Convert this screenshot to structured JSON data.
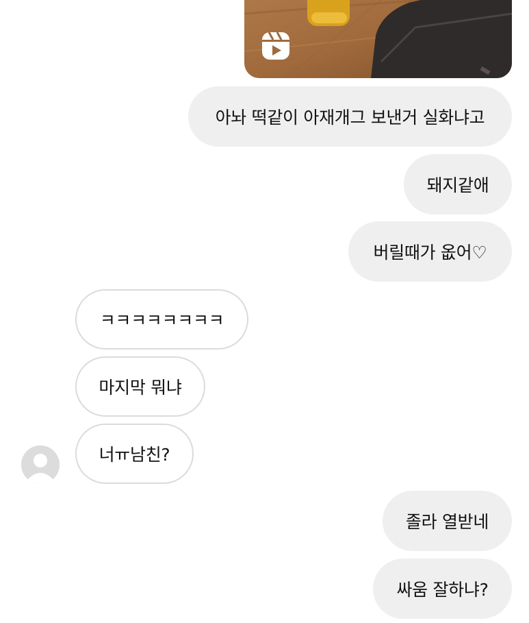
{
  "thread": {
    "shared_reel": {
      "icon": "reels-icon"
    },
    "messages": [
      {
        "id": "m1",
        "direction": "outgoing",
        "text": "아놔 떡같이 아재개그 보낸거 실화냐고"
      },
      {
        "id": "m2",
        "direction": "outgoing",
        "text": "돼지같애"
      },
      {
        "id": "m3",
        "direction": "outgoing",
        "text": "버릴때가 옶어♡"
      },
      {
        "id": "m4",
        "direction": "incoming",
        "text": "ㅋㅋㅋㅋㅋㅋㅋㅋ"
      },
      {
        "id": "m5",
        "direction": "incoming",
        "text": "마지막 뭐냐"
      },
      {
        "id": "m6",
        "direction": "incoming",
        "text": "너ㅠ남친?"
      },
      {
        "id": "m7",
        "direction": "outgoing",
        "text": "졸라 열받네"
      },
      {
        "id": "m8",
        "direction": "outgoing",
        "text": "싸움 잘하냐?"
      }
    ],
    "avatar_icon": "default-profile-avatar-icon"
  },
  "colors": {
    "outgoing_bubble": "#efefef",
    "incoming_border": "#dbdbdb",
    "text": "#111111",
    "avatar_bg": "#dcdcdc"
  }
}
